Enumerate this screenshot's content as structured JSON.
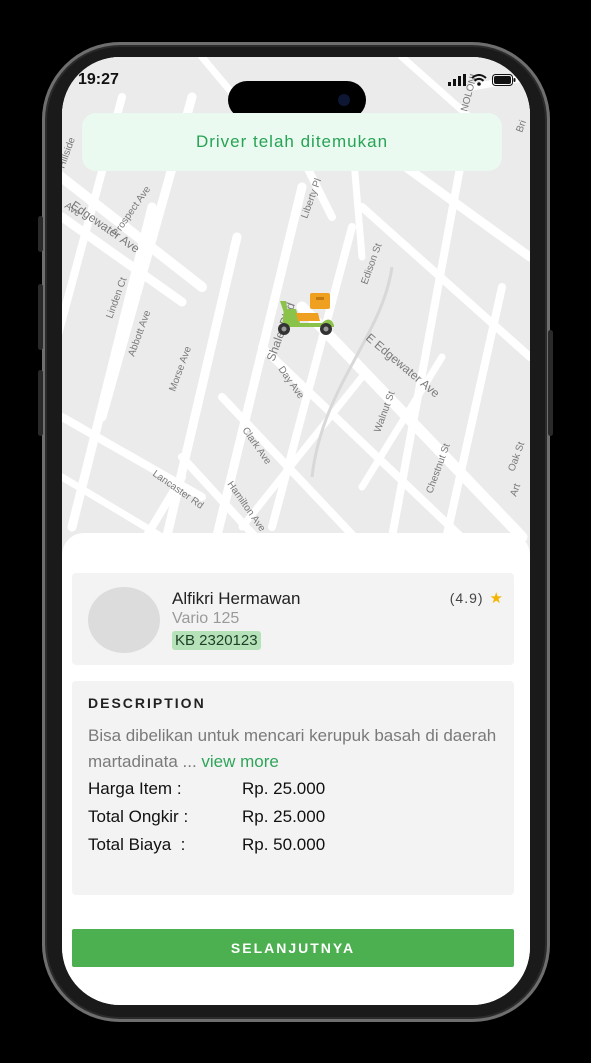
{
  "status_bar": {
    "time": "19:27"
  },
  "banner": {
    "text": "Driver telah ditemukan"
  },
  "map": {
    "streets": [
      "Edgewater Ave",
      "Prospect Ave",
      "Liberty Pl",
      "Edison St",
      "Linden Ct",
      "Abbott Ave",
      "Morse Ave",
      "Shaler Blvd",
      "E Edgewater Ave",
      "Day Ave",
      "Walnut St",
      "Clark Ave",
      "Chestnut St",
      "Lancaster Rd",
      "Hamilton Ave",
      "Oak St",
      "Art",
      "Hillside",
      "Ave",
      "Bri",
      "NOLONI"
    ]
  },
  "driver": {
    "name": "Alfikri Hermawan",
    "vehicle": "Vario 125",
    "plate": "KB 2320123",
    "rating": "(4.9)"
  },
  "description": {
    "title": "DESCRIPTION",
    "text": "Bisa dibelikan untuk mencari kerupuk basah di daerah martadinata ...",
    "view_more": "view more"
  },
  "pricing": [
    {
      "label": "Harga Item",
      "sep": ":",
      "value": "Rp. 25.000"
    },
    {
      "label": "Total Ongkir",
      "sep": ":",
      "value": "Rp. 25.000"
    },
    {
      "label": "Total Biaya",
      "sep": ":",
      "value": "Rp. 50.000"
    }
  ],
  "cta": {
    "label": "SELANJUTNYA"
  },
  "colors": {
    "accent": "#4caf50",
    "banner_text": "#27a354",
    "banner_bg": "#eafaf0",
    "star": "#f5b400"
  }
}
